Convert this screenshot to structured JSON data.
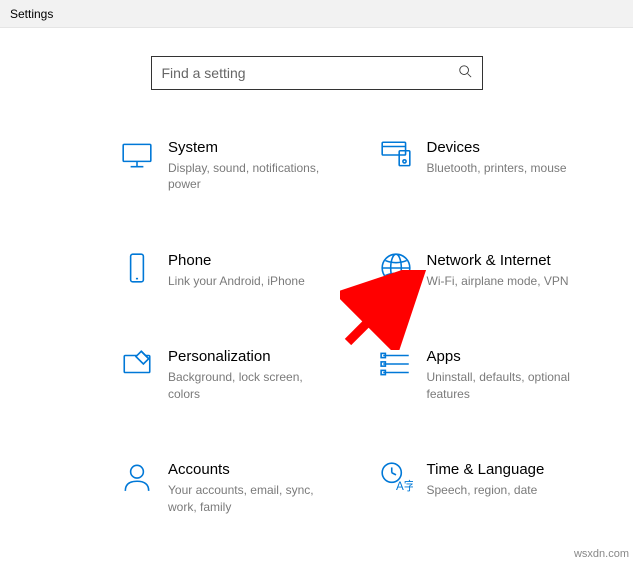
{
  "window": {
    "title": "Settings"
  },
  "search": {
    "placeholder": "Find a setting"
  },
  "categories": [
    {
      "id": "system",
      "title": "System",
      "desc": "Display, sound, notifications, power"
    },
    {
      "id": "devices",
      "title": "Devices",
      "desc": "Bluetooth, printers, mouse"
    },
    {
      "id": "phone",
      "title": "Phone",
      "desc": "Link your Android, iPhone"
    },
    {
      "id": "network",
      "title": "Network & Internet",
      "desc": "Wi-Fi, airplane mode, VPN"
    },
    {
      "id": "personalization",
      "title": "Personalization",
      "desc": "Background, lock screen, colors"
    },
    {
      "id": "apps",
      "title": "Apps",
      "desc": "Uninstall, defaults, optional features"
    },
    {
      "id": "accounts",
      "title": "Accounts",
      "desc": "Your accounts, email, sync, work, family"
    },
    {
      "id": "time",
      "title": "Time & Language",
      "desc": "Speech, region, date"
    }
  ],
  "accent_color": "#0078d7",
  "annotation": {
    "arrow_color": "#ff0000",
    "target": "network"
  },
  "watermark": "wsxdn.com"
}
